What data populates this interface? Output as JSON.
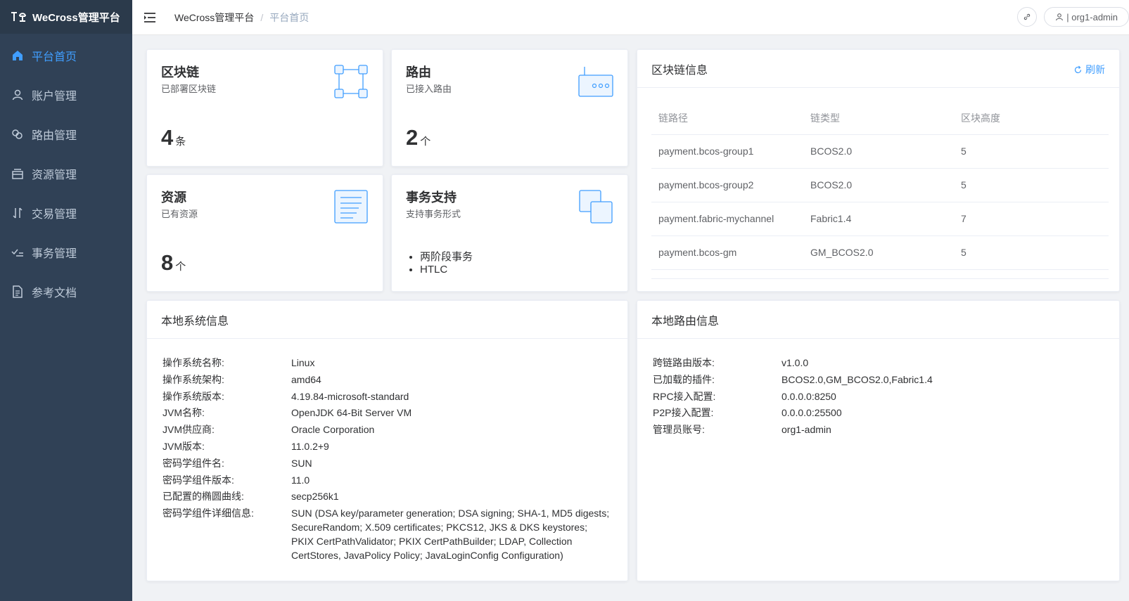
{
  "app": {
    "name": "WeCross管理平台"
  },
  "sidebar": {
    "items": [
      {
        "label": "平台首页",
        "icon": "home-icon",
        "active": true
      },
      {
        "label": "账户管理",
        "icon": "user-icon",
        "active": false
      },
      {
        "label": "路由管理",
        "icon": "route-icon",
        "active": false
      },
      {
        "label": "资源管理",
        "icon": "resource-icon",
        "active": false
      },
      {
        "label": "交易管理",
        "icon": "transaction-icon",
        "active": false
      },
      {
        "label": "事务管理",
        "icon": "checklist-icon",
        "active": false
      },
      {
        "label": "参考文档",
        "icon": "document-icon",
        "active": false
      }
    ]
  },
  "header": {
    "breadcrumb": {
      "home": "WeCross管理平台",
      "separator": "/",
      "current": "平台首页"
    },
    "user": "| org1-admin"
  },
  "stats": {
    "blockchain": {
      "title": "区块链",
      "subtitle": "已部署区块链",
      "value": "4",
      "unit": "条"
    },
    "router": {
      "title": "路由",
      "subtitle": "已接入路由",
      "value": "2",
      "unit": "个"
    },
    "resource": {
      "title": "资源",
      "subtitle": "已有资源",
      "value": "8",
      "unit": "个"
    },
    "transaction": {
      "title": "事务支持",
      "subtitle": "支持事务形式",
      "items": [
        "两阶段事务",
        "HTLC"
      ]
    }
  },
  "chain_info": {
    "title": "区块链信息",
    "refresh": "刷新",
    "columns": [
      "链路径",
      "链类型",
      "区块高度"
    ],
    "rows": [
      [
        "payment.bcos-group1",
        "BCOS2.0",
        "5"
      ],
      [
        "payment.bcos-group2",
        "BCOS2.0",
        "5"
      ],
      [
        "payment.fabric-mychannel",
        "Fabric1.4",
        "7"
      ],
      [
        "payment.bcos-gm",
        "GM_BCOS2.0",
        "5"
      ]
    ]
  },
  "system_info": {
    "title": "本地系统信息",
    "rows": [
      {
        "key": "操作系统名称:",
        "value": "Linux"
      },
      {
        "key": "操作系统架构:",
        "value": "amd64"
      },
      {
        "key": "操作系统版本:",
        "value": "4.19.84-microsoft-standard"
      },
      {
        "key": "JVM名称:",
        "value": "OpenJDK 64-Bit Server VM"
      },
      {
        "key": "JVM供应商:",
        "value": "Oracle Corporation"
      },
      {
        "key": "JVM版本:",
        "value": "11.0.2+9"
      },
      {
        "key": "密码学组件名:",
        "value": "SUN"
      },
      {
        "key": "密码学组件版本:",
        "value": "11.0"
      },
      {
        "key": "已配置的椭圆曲线:",
        "value": "secp256k1"
      },
      {
        "key": "密码学组件详细信息:",
        "value": "SUN (DSA key/parameter generation; DSA signing; SHA-1, MD5 digests; SecureRandom; X.509 certificates; PKCS12, JKS & DKS keystores; PKIX CertPathValidator; PKIX CertPathBuilder; LDAP, Collection CertStores, JavaPolicy Policy; JavaLoginConfig Configuration)"
      }
    ]
  },
  "router_info": {
    "title": "本地路由信息",
    "rows": [
      {
        "key": "跨链路由版本:",
        "value": "v1.0.0"
      },
      {
        "key": "已加载的插件:",
        "value": "BCOS2.0,GM_BCOS2.0,Fabric1.4"
      },
      {
        "key": "RPC接入配置:",
        "value": "0.0.0.0:8250"
      },
      {
        "key": "P2P接入配置:",
        "value": "0.0.0.0:25500"
      },
      {
        "key": "管理员账号:",
        "value": "org1-admin"
      }
    ]
  },
  "colors": {
    "sidebar_bg": "#304156",
    "active": "#409eff",
    "menu_text": "#bfcbd9"
  }
}
